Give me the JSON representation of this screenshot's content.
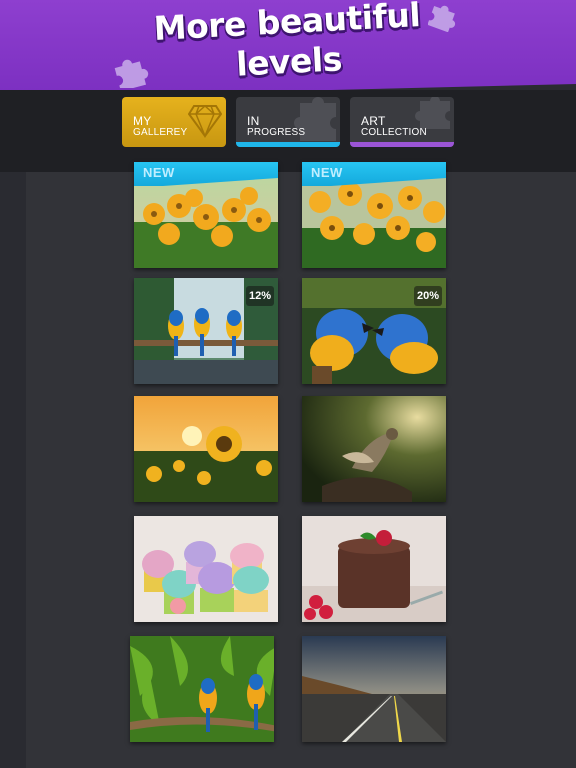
{
  "banner": {
    "title_line1": "More beautiful",
    "title_line2": "levels"
  },
  "tabs": [
    {
      "line1": "MY",
      "line2": "GALLEREY",
      "bar_color": "#e6b21d",
      "icon": "diamond-icon"
    },
    {
      "line1": "IN",
      "line2": "PROGRESS",
      "bar_color": "#1fb6ea",
      "icon": "puzzle-icon"
    },
    {
      "line1": "ART",
      "line2": "COLLECTION",
      "bar_color": "#9b55d6",
      "icon": "puzzle-icon"
    }
  ],
  "gallery": {
    "items": [
      {
        "subject": "yellow flowers",
        "badge": "NEW"
      },
      {
        "subject": "yellow flowers",
        "badge": "NEW"
      },
      {
        "subject": "parrots at waterfall",
        "progress": "12%"
      },
      {
        "subject": "kissing parrots",
        "progress": "20%"
      },
      {
        "subject": "sunflower sunset"
      },
      {
        "subject": "hawk on branch"
      },
      {
        "subject": "cupcakes"
      },
      {
        "subject": "chocolate dessert"
      },
      {
        "subject": "parrots in jungle"
      },
      {
        "subject": "desert road"
      }
    ]
  },
  "colors": {
    "banner": "#8e3fcf",
    "gallery_tab": "#e6b21d",
    "progress_tab": "#1fb6ea",
    "art_tab": "#9b55d6",
    "new_ribbon": "#1fb6ea"
  }
}
